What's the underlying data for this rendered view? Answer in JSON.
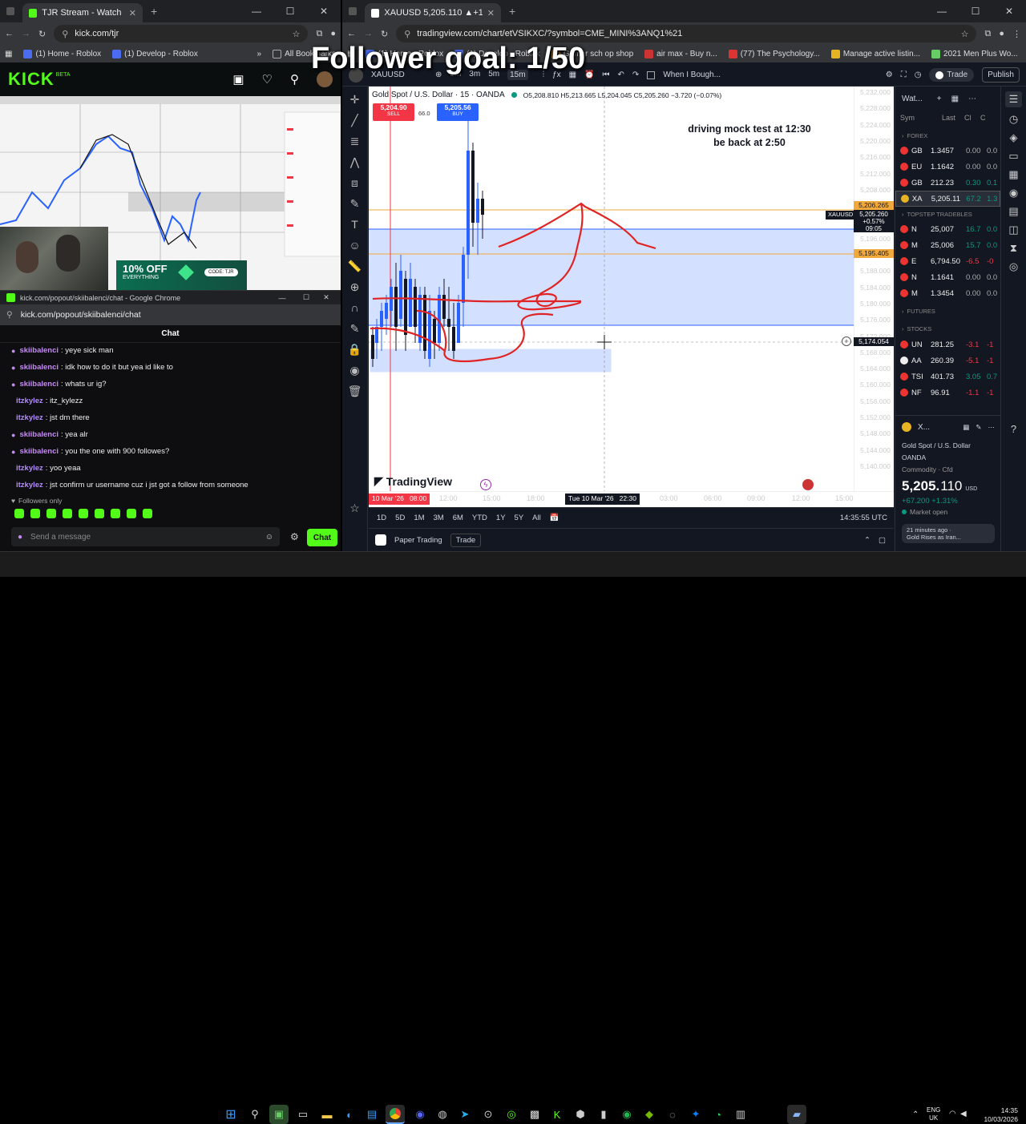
{
  "overlay": {
    "follower_goal": "Follower goal: 1/50"
  },
  "left_browser": {
    "tab_title": "TJR Stream - Watch Live on",
    "url": "kick.com/tjr",
    "bookmarks": [
      "(1) Home - Roblox",
      "(1) Develop - Roblox"
    ],
    "all_bookmarks": "All Bookmarks",
    "kick_logo": "KICK",
    "kick_beta": "BETA",
    "ad_text1": "10% OFF",
    "ad_text2": "EVERYTHING",
    "ad_code": "CODE: TJR"
  },
  "chat_popout": {
    "window_title": "kick.com/popout/skiibalenci/chat - Google Chrome",
    "url": "kick.com/popout/skiibalenci/chat",
    "header": "Chat",
    "messages": [
      {
        "user": "skiibalenci",
        "text": ": yeye sick man",
        "color": "#c58bf5",
        "badge": true
      },
      {
        "user": "skiibalenci",
        "text": ": idk how to do it but yea id like to",
        "color": "#c58bf5",
        "badge": true
      },
      {
        "user": "skiibalenci",
        "text": ": whats ur ig?",
        "color": "#c58bf5",
        "badge": true
      },
      {
        "user": "itzkylez",
        "text": ": itz_kylezz",
        "color": "#b48cff",
        "badge": false
      },
      {
        "user": "itzkylez",
        "text": ": jst dm there",
        "color": "#b48cff",
        "badge": false
      },
      {
        "user": "skiibalenci",
        "text": ": yea alr",
        "color": "#c58bf5",
        "badge": true
      },
      {
        "user": "skiibalenci",
        "text": ": you the one with 900 followes?",
        "color": "#c58bf5",
        "badge": true
      },
      {
        "user": "itzkylez",
        "text": ": yoo yeaa",
        "color": "#b48cff",
        "badge": false
      },
      {
        "user": "itzkylez",
        "text": ": jst confirm ur username cuz i jst got a follow from someone",
        "color": "#b48cff",
        "badge": false
      }
    ],
    "followers_only": "Followers only",
    "input_placeholder": "Send a message",
    "chat_button": "Chat"
  },
  "right_browser": {
    "tab_title": "XAUUSD 5,205.110 ▲+1.31%",
    "url": "tradingview.com/chart/etVSIKXC/?symbol=CME_MINI%3ANQ1%21",
    "bookmarks": [
      "(1) Home - Roblox",
      "(1) Develop - Roblox",
      "Gamer sch op shop",
      "air max - Buy n...",
      "(77) The Psychology...",
      "Manage active listin...",
      "2021 Men Plus Wo..."
    ],
    "all_bookmarks": "All Bookmarks"
  },
  "tradingview": {
    "symbol": "XAUUSD",
    "intervals": [
      "1m",
      "3m",
      "5m",
      "15m"
    ],
    "alert_name": "When I Bough...",
    "trade_btn": "Trade",
    "publish_btn": "Publish",
    "instrument": "Gold Spot / U.S. Dollar · 15 · OANDA",
    "ohlc": "O5,208.810 H5,213.665 L5,204.045 C5,205.260 −3.720 (−0.07%)",
    "sell_price": "5,204.90",
    "sell_label": "SELL",
    "spread": "66.0",
    "buy_price": "5,205.56",
    "buy_label": "BUY",
    "note_line1": "driving mock test at 12:30",
    "note_line2": "be back at 2:50",
    "logo": "TradingView",
    "price_axis": [
      "5,232.000",
      "5,228.000",
      "5,224.000",
      "5,220.000",
      "5,216.000",
      "5,212.000",
      "5,208.000",
      "5,204.000",
      "5,200.000",
      "5,196.000",
      "5,192.000",
      "5,188.000",
      "5,184.000",
      "5,180.000",
      "5,176.000",
      "5,172.000",
      "5,168.000",
      "5,164.000",
      "5,160.000",
      "5,156.000",
      "5,152.000",
      "5,148.000",
      "5,144.000",
      "5,140.000"
    ],
    "price_markers": {
      "upper_level": "5,206.265",
      "symbol_tag": "XAUUSD",
      "current": "5,205.260",
      "current_change": "+0.57%",
      "countdown": "09:05",
      "mid_level": "5,195.405",
      "crosshair": "5,174.054"
    },
    "time_axis": [
      "12:00",
      "15:00",
      "18:00",
      "03:00",
      "06:00",
      "09:00",
      "12:00",
      "15:00"
    ],
    "time_start_label": "10 Mar '26   08:00",
    "time_crosshair_label": "Tue 10 Mar '26   22:30",
    "ranges": [
      "1D",
      "5D",
      "1M",
      "3M",
      "6M",
      "YTD",
      "1Y",
      "5Y",
      "All"
    ],
    "clock": "14:35:55 UTC",
    "paper_trading": "Paper Trading",
    "trade_tab": "Trade"
  },
  "watchlist": {
    "title": "Wat...",
    "cols": [
      "Sym",
      "Last",
      "Cl",
      "C"
    ],
    "sections": {
      "forex": "FOREX",
      "topstep": "TOPSTEP TRADEBLES",
      "futures": "FUTURES",
      "stocks": "STOCKS"
    },
    "forex": [
      {
        "sym": "GB",
        "last": "1.3457",
        "chg": "0.00",
        "pct": "0.0",
        "color": "#e33",
        "dir": "flat"
      },
      {
        "sym": "EU",
        "last": "1.1642",
        "chg": "0.00",
        "pct": "0.0",
        "color": "#e33",
        "dir": "flat"
      },
      {
        "sym": "GB",
        "last": "212.23",
        "chg": "0.30",
        "pct": "0.1",
        "color": "#e33",
        "dir": "up"
      },
      {
        "sym": "XA",
        "last": "5,205.11",
        "chg": "67.2",
        "pct": "1.3",
        "color": "#e6b422",
        "dir": "up"
      }
    ],
    "topstep": [
      {
        "sym": "N",
        "last": "25,007",
        "chg": "16.7",
        "pct": "0.0",
        "color": "#e33",
        "dir": "up"
      },
      {
        "sym": "M",
        "last": "25,006",
        "chg": "15.7",
        "pct": "0.0",
        "color": "#e33",
        "dir": "up"
      },
      {
        "sym": "E",
        "last": "6,794.50",
        "chg": "-6.5",
        "pct": "-0",
        "color": "#e33",
        "dir": "down"
      },
      {
        "sym": "N",
        "last": "1.1641",
        "chg": "0.00",
        "pct": "0.0",
        "color": "#e33",
        "dir": "flat"
      },
      {
        "sym": "M",
        "last": "1.3454",
        "chg": "0.00",
        "pct": "0.0",
        "color": "#e33",
        "dir": "flat"
      }
    ],
    "stocks": [
      {
        "sym": "UN",
        "last": "281.25",
        "chg": "-3.1",
        "pct": "-1",
        "color": "#e33",
        "dir": "down"
      },
      {
        "sym": "AA",
        "last": "260.39",
        "chg": "-5.1",
        "pct": "-1",
        "color": "#eee",
        "dir": "down"
      },
      {
        "sym": "TSI",
        "last": "401.73",
        "chg": "3.05",
        "pct": "0.7",
        "color": "#e33",
        "dir": "up"
      },
      {
        "sym": "NF",
        "last": "96.91",
        "chg": "-1.1",
        "pct": "-1",
        "color": "#e33",
        "dir": "down"
      }
    ],
    "detail_sym": "X...",
    "detail_name": "Gold Spot / U.S. Dollar",
    "detail_exchange": "OANDA",
    "detail_type": "Commodity · Cfd",
    "detail_price_main": "5,205.",
    "detail_price_frac": "110",
    "detail_currency": "USD",
    "detail_change": "+67.200 +1.31%",
    "detail_market": "Market open",
    "news_time": "21 minutes ago ·",
    "news_head": "Gold Rises as Iran..."
  },
  "taskbar": {
    "lang1": "ENG",
    "lang2": "UK",
    "time": "14:35",
    "date": "10/03/2026"
  }
}
